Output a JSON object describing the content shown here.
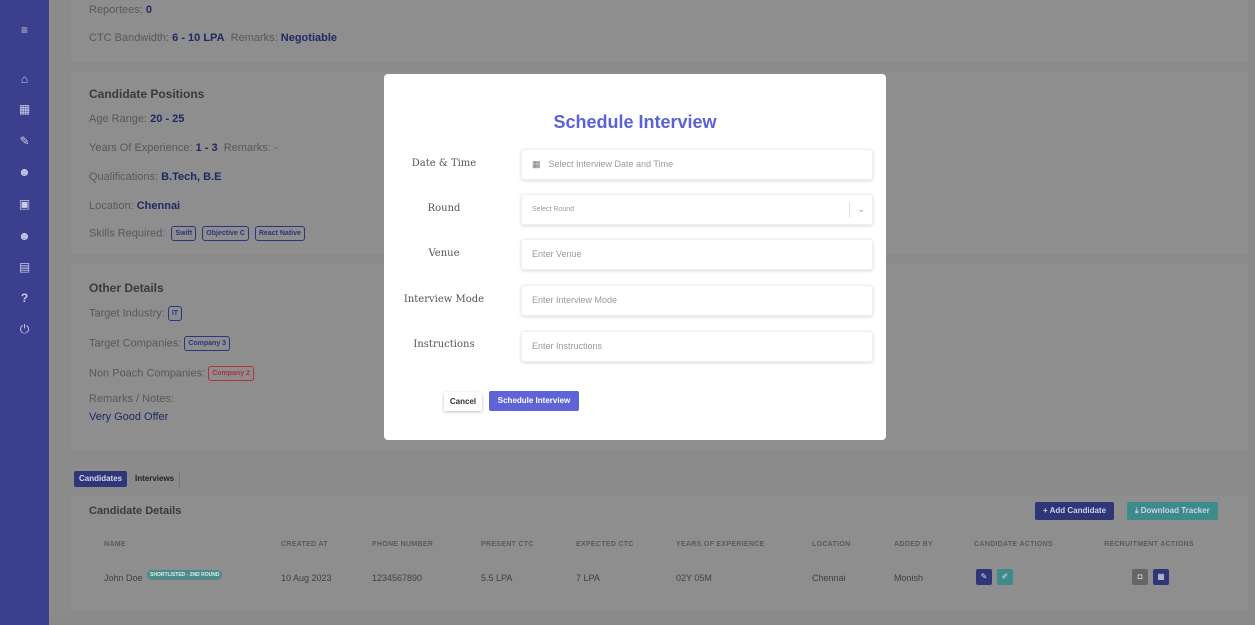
{
  "sidebar": {
    "icons": [
      "menu-icon",
      "home-icon",
      "building-icon",
      "edit-icon",
      "users-icon",
      "calendar-icon",
      "team-icon",
      "document-icon",
      "help-icon",
      "power-icon"
    ],
    "glyphs": [
      "≡",
      "⌂",
      "▦",
      "✎",
      "☻",
      "▣",
      "☻",
      "▤",
      "?",
      "⏻"
    ]
  },
  "reportees": {
    "label": "Reportees:",
    "value": "0"
  },
  "ctc": {
    "label": "CTC Bandwidth:",
    "value": "6 - 10 LPA",
    "remarks_label": "Remarks:",
    "remarks_value": "Negotiable"
  },
  "candidate_positions": {
    "title": "Candidate Positions",
    "age_label": "Age Range:",
    "age_value": "20 - 25",
    "exp_label": "Years Of Experience:",
    "exp_value": "1 - 3",
    "exp_remarks": "Remarks: -",
    "qual_label": "Qualifications:",
    "qual_value": "B.Tech, B.E",
    "loc_label": "Location:",
    "loc_value": "Chennai",
    "skills_label": "Skills Required:",
    "skills": [
      "Swift",
      "Objective C",
      "React Native"
    ]
  },
  "other_details": {
    "title": "Other Details",
    "industry_label": "Target Industry:",
    "industry": "IT",
    "companies_label": "Target Companies:",
    "company": "Company 3",
    "nonpoach_label": "Non Poach Companies:",
    "nonpoach": "Company 2",
    "remarks_label": "Remarks / Notes:",
    "remarks": "Very Good Offer"
  },
  "tabs": {
    "candidates": "Candidates",
    "interviews": "Interviews"
  },
  "candidate_details": {
    "title": "Candidate Details",
    "add_button": "+ Add Candidate",
    "download_button": "Download Tracker",
    "columns": [
      "NAME",
      "CREATED AT",
      "PHONE NUMBER",
      "PRESENT CTC",
      "EXPECTED CTC",
      "YEARS OF EXPERIENCE",
      "LOCATION",
      "ADDED BY",
      "CANDIDATE ACTIONS",
      "RECRUITMENT ACTIONS"
    ],
    "row": {
      "name": "John Doe",
      "status": "SHORTLISTED - 2ND ROUND",
      "created_at": "10 Aug 2023",
      "phone": "1234567890",
      "present_ctc": "5.5 LPA",
      "expected_ctc": "7 LPA",
      "experience": "02Y 05M",
      "location": "Chennai",
      "added_by": "Monish"
    }
  },
  "modal": {
    "title": "Schedule Interview",
    "fields": {
      "datetime_label": "Date & Time",
      "datetime_placeholder": "Select Interview Date and Time",
      "round_label": "Round",
      "round_placeholder": "Select Round",
      "venue_label": "Venue",
      "venue_placeholder": "Enter Venue",
      "mode_label": "Interview Mode",
      "mode_placeholder": "Enter Interview Mode",
      "instructions_label": "Instructions",
      "instructions_placeholder": "Enter Instructions"
    },
    "cancel": "Cancel",
    "submit": "Schedule Interview"
  },
  "colors": {
    "sidebar": "#3b3f8e",
    "accent": "#5e64d8",
    "overlay": "#8a8a8a"
  }
}
